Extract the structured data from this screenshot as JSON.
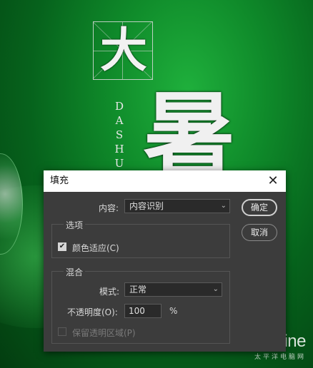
{
  "background": {
    "headline_char": "大",
    "vertical_text": "DASHU",
    "big_char": "暑",
    "watermark_brand": "PConline",
    "watermark_sub": "太平洋电脑网"
  },
  "dialog": {
    "title": "填充",
    "content_label": "内容:",
    "content_value": "内容识别",
    "ok_button": "确定",
    "cancel_button": "取消",
    "options_group": {
      "title": "选项",
      "color_adapt_label": "颜色适应(C)",
      "color_adapt_checked": true
    },
    "blend_group": {
      "title": "混合",
      "mode_label": "模式:",
      "mode_value": "正常",
      "opacity_label": "不透明度(O):",
      "opacity_value": "100",
      "opacity_unit": "%",
      "preserve_transparency_label": "保留透明区域(P)",
      "preserve_transparency_checked": false
    }
  }
}
